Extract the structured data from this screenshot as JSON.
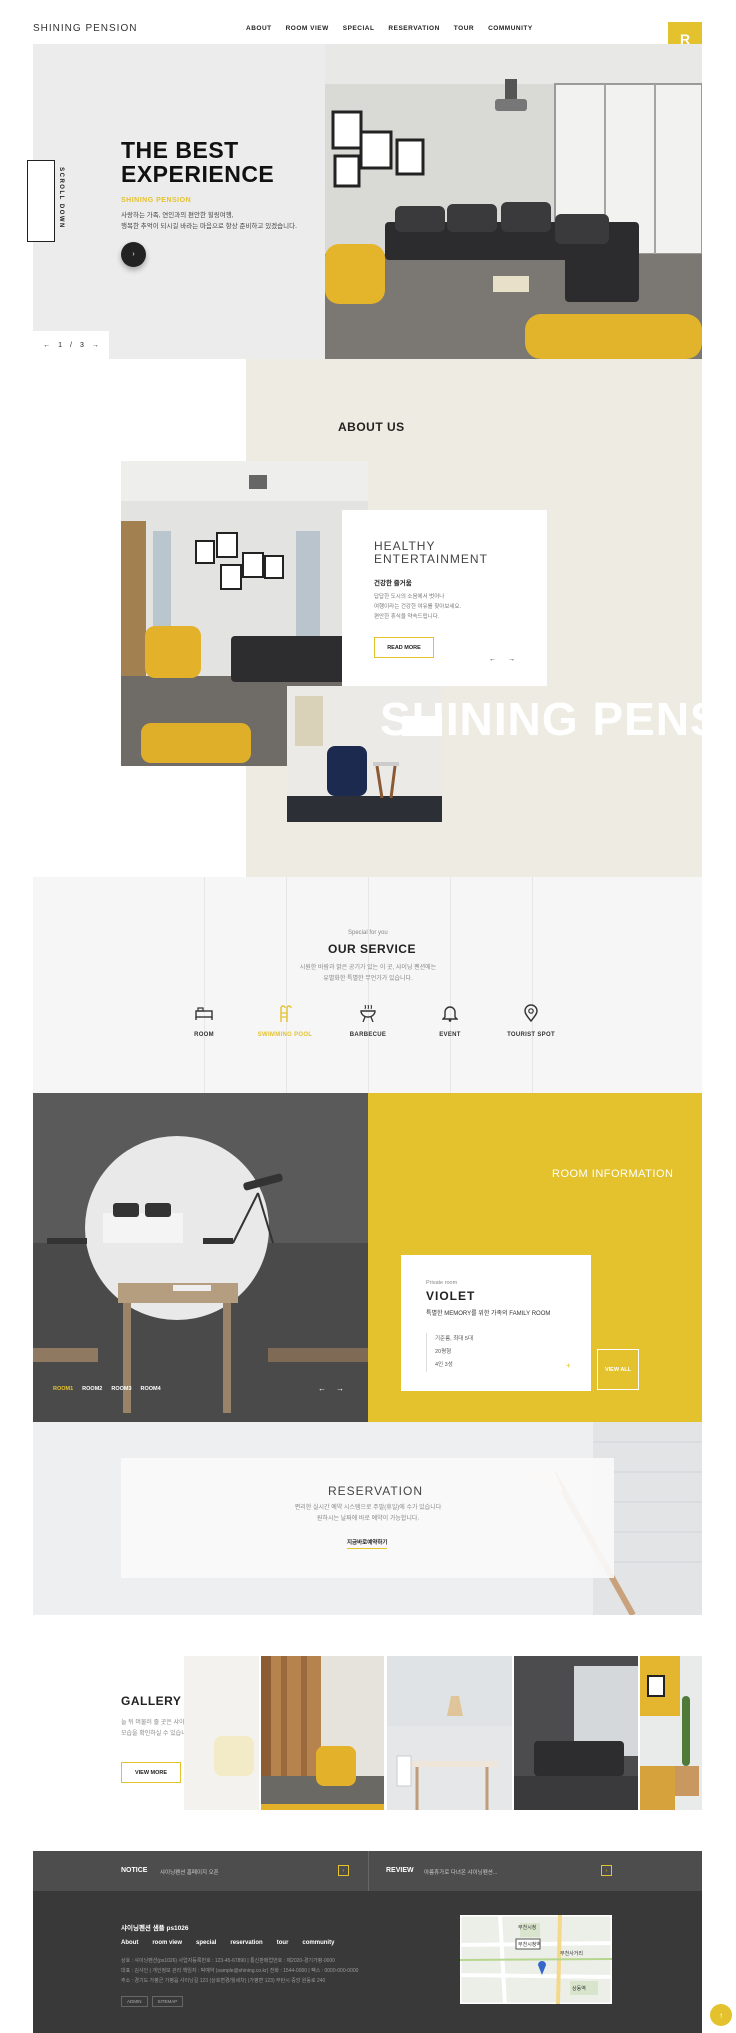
{
  "header": {
    "logo": "SHINING PENSION",
    "nav": [
      "ABOUT",
      "ROOM VIEW",
      "SPECIAL",
      "RESERVATION",
      "TOUR",
      "COMMUNITY"
    ],
    "badge": "R"
  },
  "hero": {
    "scroll_label": "SCROLL DOWN",
    "title": "THE BEST\nEXPERIENCE",
    "subtitle": "SHINING PENSION",
    "description": "사랑하는 가족, 연인과의 편안한 힐링여행,\n행복한 추억이 되시길 바라는 마음으로 항상 준비하고 있겠습니다.",
    "play": "›",
    "pager": {
      "prev": "←",
      "current": "1",
      "sep": "/",
      "total": "3",
      "next": "→"
    }
  },
  "about": {
    "title": "ABOUT US",
    "card_heading": "HEALTHY\nENTERTAINMENT",
    "card_kr_title": "건강한 즐거움",
    "card_text": "답답한 도시의 소음에서 벗어나\n여행이라는 건강한 여유를 찾아보세요.\n편안한 휴식을 약속드립니다.",
    "read_more": "READ MORE",
    "prev": "←",
    "next": "→",
    "big_text": "SHINING PENSION"
  },
  "service": {
    "special": "Special for you",
    "title": "OUR SERVICE",
    "description": "시원한 바람과 맑은 공기가 있는 이 곳, 샤이닝 펜션에는\n유별화한 특별한 무언가가 있습니다.",
    "items": [
      {
        "label": "ROOM",
        "icon": "bed-icon"
      },
      {
        "label": "SWIMMING POOL",
        "icon": "pool-ladder-icon"
      },
      {
        "label": "BARBECUE",
        "icon": "grill-icon"
      },
      {
        "label": "EVENT",
        "icon": "bell-icon"
      },
      {
        "label": "TOURIST SPOT",
        "icon": "map-pin-icon"
      }
    ],
    "active_index": 1
  },
  "room": {
    "heading": "ROOM INFORMATION",
    "card_small": "Private room",
    "card_name": "VIOLET",
    "card_desc": "특별한 MEMORY를 위한 가족의 FAMILY ROOM",
    "card_list": [
      "기준룸, 최대 5대",
      "20평형",
      "4인 3성"
    ],
    "card_plus": "+",
    "view_all": "VIEW ALL",
    "tabs": [
      "ROOM1",
      "ROOM2",
      "ROOM3",
      "ROOM4"
    ],
    "active_tab": 0,
    "prev": "←",
    "next": "→"
  },
  "reservation": {
    "title": "RESERVATION",
    "text": "편리한 실시간 예약 시스템으로 주말(휴일)에 수가 있습니다\n원하시는 날짜에 바로 예약이 가능합니다.",
    "link": "지금바로예약하기"
  },
  "gallery": {
    "title": "GALLERY",
    "text": "늘 뒤 머물러 줄 곳은 샤이닝펜션의\n모습을 확인하실 수 있습니다.",
    "button": "VIEW MORE"
  },
  "notice_bar": {
    "notice_label": "NOTICE",
    "notice_text": "샤이닝펜션 홈페이지 오픈",
    "review_label": "REVIEW",
    "review_text": "아름휴가로 다녀온 샤이닝펜션...",
    "btn": "›"
  },
  "footer": {
    "title": "샤이닝펜션 샘플 ps1026",
    "menu": [
      "About",
      "room view",
      "special",
      "reservation",
      "tour",
      "community"
    ],
    "info": "상호 : 샤이닝펜션(ps1026) 사업자등록번호 : 123-45-67890 | 통신판매업번호 : 제2020-경기가평-0000\n대표 : 김샤인 | 개인정보 관리 책임자 : 박예약 (sample@shining.co.kr) 전화 : 1544-0000 | 팩스 : 0000-000-0000\n주소 : 경기도 가평군 가평읍 샤이닝길 123 (상호변경/월세차) (가평면 123) 부탄시 중앙 원동로 240",
    "buttons": [
      "ADMIN",
      "SITEMAP"
    ],
    "map_labels": [
      "부천시청",
      "부천시청역",
      "부천사거리",
      "상동역"
    ],
    "top": "↑"
  },
  "colors": {
    "accent": "#e4c22e",
    "dark": "#393939",
    "beige": "#eeece2"
  }
}
